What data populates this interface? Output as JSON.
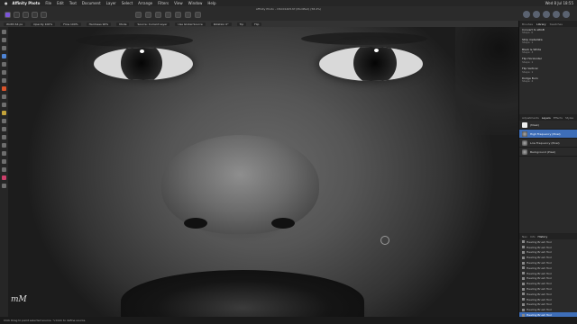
{
  "menubar": {
    "apple": "",
    "app": "Affinity Photo",
    "items": [
      "File",
      "Edit",
      "Text",
      "Document",
      "Layer",
      "Select",
      "Arrange",
      "Filters",
      "View",
      "Window",
      "Help"
    ],
    "clock": "Wed 8 Jul 18:55"
  },
  "toolbar": {
    "title": "Affinity Photo – DSC01405.tif (Modified) (58.4%)"
  },
  "context": {
    "segments": [
      "Width 64 px",
      "Opacity 100%",
      "Flow 100%",
      "Hardness 90%",
      "Mode",
      "Source: Current Layer",
      "Use Global Source",
      "Rotation 0°",
      "Tip",
      "Flip"
    ]
  },
  "library": {
    "tabs": [
      "Brushes",
      "Library",
      "Swatches"
    ],
    "items": [
      {
        "title": "Convert to sRGB",
        "sub": "Steps: 0"
      },
      {
        "title": "Strip metadata",
        "sub": "Steps: 1"
      },
      {
        "title": "Black & White",
        "sub": "Steps: 3"
      },
      {
        "title": "Flip Horizontal",
        "sub": "Steps: 1"
      },
      {
        "title": "Flip Vertical",
        "sub": "Steps: 1"
      },
      {
        "title": "Dodge Burn",
        "sub": "Steps: 4"
      }
    ]
  },
  "layers": {
    "tabs": [
      "Adjustments",
      "Layers",
      "Effects",
      "Styles"
    ],
    "items": [
      {
        "name": "(Mask)",
        "selected": false,
        "thumb": "white"
      },
      {
        "name": "High Frequency (Pixel)",
        "selected": true,
        "thumb": "face"
      },
      {
        "name": "Low Frequency (Pixel)",
        "selected": false,
        "thumb": "face"
      },
      {
        "name": "Background (Pixel)",
        "selected": false,
        "thumb": "face"
      }
    ]
  },
  "history": {
    "tabs": [
      "Nav",
      "Info",
      "History"
    ],
    "items": [
      "Healing Brush Tool",
      "Healing Brush Tool",
      "Healing Brush Tool",
      "Healing Brush Tool",
      "Healing Brush Tool",
      "Healing Brush Tool",
      "Healing Brush Tool",
      "Healing Brush Tool",
      "Healing Brush Tool",
      "Healing Brush Tool",
      "Healing Brush Tool",
      "Healing Brush Tool",
      "Healing Brush Tool",
      "Healing Brush Tool",
      "Healing Brush Tool"
    ]
  },
  "canvas": {
    "signature": "mM"
  },
  "status": {
    "text": "Click Drag to paint selected source. ⌥Click to define source."
  }
}
